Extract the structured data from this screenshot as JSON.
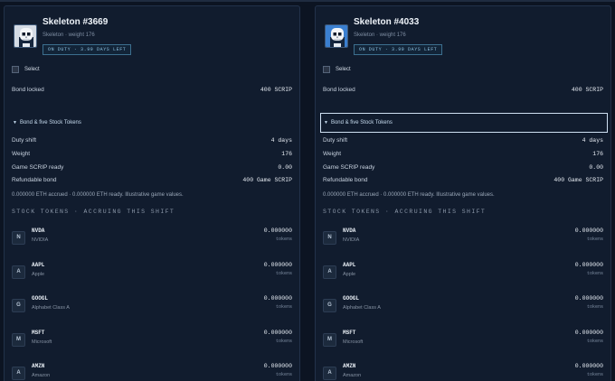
{
  "cards": [
    {
      "name": "Skeleton #3669",
      "subtitle": "Skeleton · weight 176",
      "status_badge": "ON DUTY · 3.99 DAYS LEFT",
      "select_label": "Select",
      "bond_locked_label": "Bond locked",
      "bond_locked_value": "400 SCRIP",
      "disclosure_label": "Bond & five Stock Tokens",
      "details": [
        {
          "label": "Duty shift",
          "value": "4 days"
        },
        {
          "label": "Weight",
          "value": "176"
        },
        {
          "label": "Game SCRIP ready",
          "value": "0.00"
        },
        {
          "label": "Refundable bond",
          "value": "400 Game SCRIP"
        }
      ],
      "note": "0.000000 ETH accrued · 0.000000 ETH ready. Illustrative game values.",
      "section_title": "STOCK TOKENS · ACCRUING THIS SHIFT",
      "tokens": [
        {
          "initial": "N",
          "symbol": "NVDA",
          "name": "NVIDIA",
          "value": "0.000000",
          "unit": "tokens"
        },
        {
          "initial": "A",
          "symbol": "AAPL",
          "name": "Apple",
          "value": "0.000000",
          "unit": "tokens"
        },
        {
          "initial": "G",
          "symbol": "GOOGL",
          "name": "Alphabet Class A",
          "value": "0.000000",
          "unit": "tokens"
        },
        {
          "initial": "M",
          "symbol": "MSFT",
          "name": "Microsoft",
          "value": "0.000000",
          "unit": "tokens"
        },
        {
          "initial": "A",
          "symbol": "AMZN",
          "name": "Amazon",
          "value": "0.000000",
          "unit": "tokens"
        }
      ]
    },
    {
      "name": "Skeleton #4033",
      "subtitle": "Skeleton · weight 176",
      "status_badge": "ON DUTY · 3.99 DAYS LEFT",
      "select_label": "Select",
      "bond_locked_label": "Bond locked",
      "bond_locked_value": "400 SCRIP",
      "disclosure_label": "Bond & five Stock Tokens",
      "details": [
        {
          "label": "Duty shift",
          "value": "4 days"
        },
        {
          "label": "Weight",
          "value": "176"
        },
        {
          "label": "Game SCRIP ready",
          "value": "0.00"
        },
        {
          "label": "Refundable bond",
          "value": "400 Game SCRIP"
        }
      ],
      "note": "0.000000 ETH accrued · 0.000000 ETH ready. Illustrative game values.",
      "section_title": "STOCK TOKENS · ACCRUING THIS SHIFT",
      "tokens": [
        {
          "initial": "N",
          "symbol": "NVDA",
          "name": "NVIDIA",
          "value": "0.000000",
          "unit": "tokens"
        },
        {
          "initial": "A",
          "symbol": "AAPL",
          "name": "Apple",
          "value": "0.000000",
          "unit": "tokens"
        },
        {
          "initial": "G",
          "symbol": "GOOGL",
          "name": "Alphabet Class A",
          "value": "0.000000",
          "unit": "tokens"
        },
        {
          "initial": "M",
          "symbol": "MSFT",
          "name": "Microsoft",
          "value": "0.000000",
          "unit": "tokens"
        },
        {
          "initial": "A",
          "symbol": "AMZN",
          "name": "Amazon",
          "value": "0.000000",
          "unit": "tokens"
        }
      ]
    }
  ]
}
